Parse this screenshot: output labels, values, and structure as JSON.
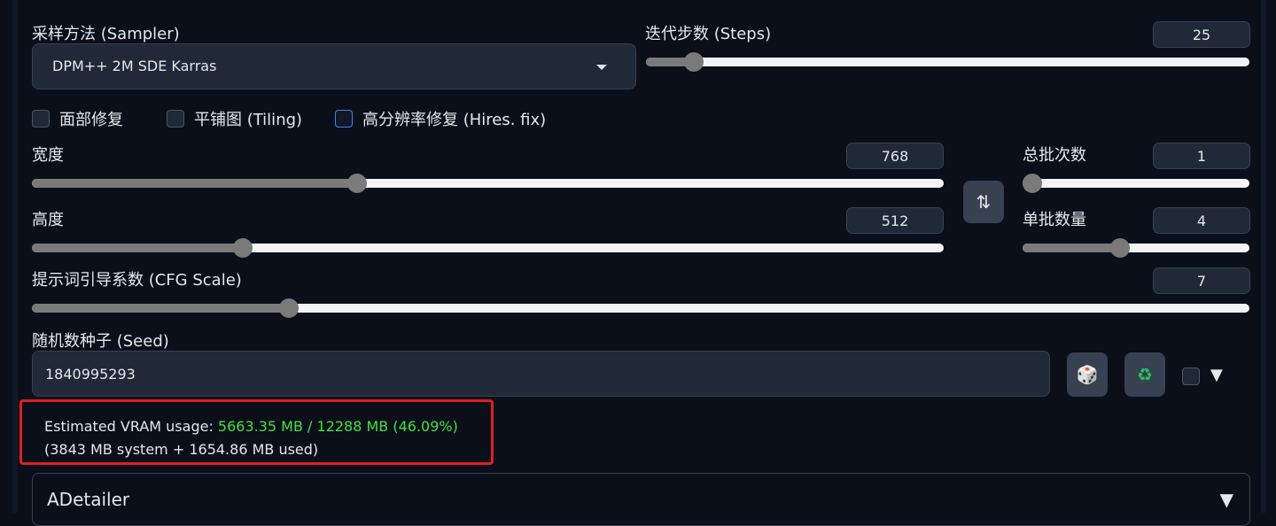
{
  "sampler": {
    "label": "采样方法 (Sampler)",
    "value": "DPM++ 2M SDE Karras"
  },
  "steps": {
    "label": "迭代步数 (Steps)",
    "value": "25",
    "fraction": 0.08
  },
  "checkboxes": [
    {
      "label": "面部修复",
      "checked": false
    },
    {
      "label": "平铺图 (Tiling)",
      "checked": false
    },
    {
      "label": "高分辨率修复 (Hires. fix)",
      "checked": false
    }
  ],
  "width": {
    "label": "宽度",
    "value": "768",
    "fraction": 0.357
  },
  "height": {
    "label": "高度",
    "value": "512",
    "fraction": 0.231
  },
  "batch_count": {
    "label": "总批次数",
    "value": "1",
    "fraction": 0.0
  },
  "batch_size": {
    "label": "单批数量",
    "value": "4",
    "fraction": 0.43
  },
  "cfg": {
    "label": "提示词引导系数 (CFG Scale)",
    "value": "7",
    "fraction": 0.211
  },
  "swap_icon": "⇅",
  "seed": {
    "label": "随机数种子 (Seed)",
    "value": "1840995293",
    "dice_icon": "🎲",
    "recycle_icon": "♻",
    "extra_arrow": "▼"
  },
  "vram": {
    "prefix": "Estimated VRAM usage: ",
    "usage": "5663.35 MB / 12288 MB (46.09%)",
    "detail": "(3843 MB system + 1654.86 MB used)"
  },
  "adetailer": {
    "title": "ADetailer",
    "arrow": "▼"
  }
}
